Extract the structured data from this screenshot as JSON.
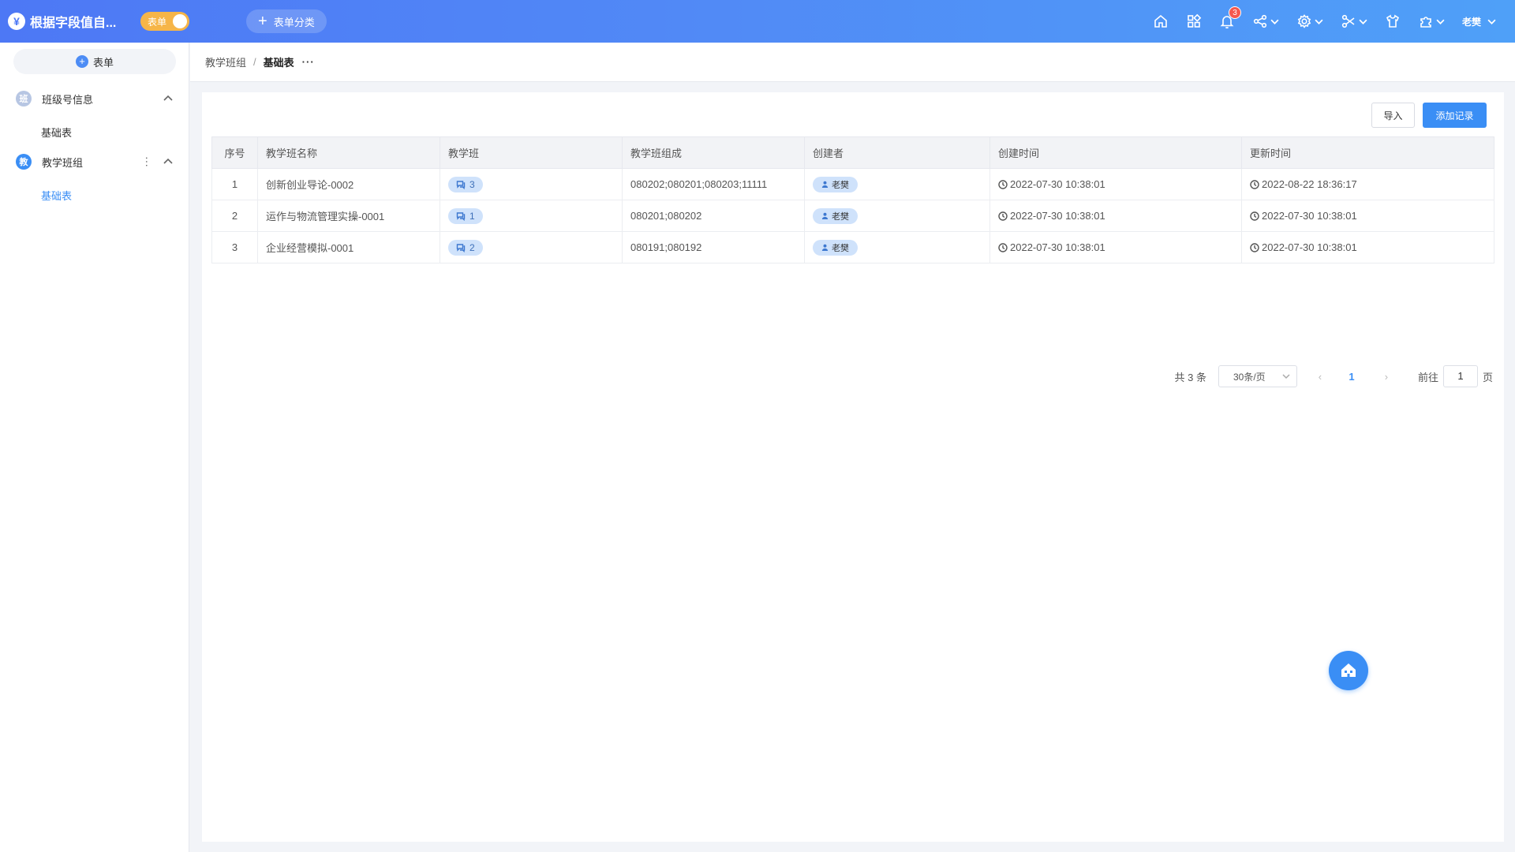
{
  "app": {
    "logo_glyph": "¥",
    "title": "根据字段值自...",
    "mode_toggle": "表单",
    "category_button": "表单分类",
    "notification_count": "3",
    "user_name": "老樊"
  },
  "sidebar": {
    "new_form_button": "表单",
    "groups": [
      {
        "avatar": "班",
        "avatar_color": "#b7c6e3",
        "label": "班级号信息",
        "items": [
          "基础表"
        ]
      },
      {
        "avatar": "教",
        "avatar_color": "#3a8ef5",
        "label": "教学班组",
        "items": [
          "基础表"
        ]
      }
    ],
    "active_item": "教学班组/基础表"
  },
  "breadcrumb": {
    "items": [
      "教学班组",
      "基础表"
    ],
    "separator": "/",
    "more": "···"
  },
  "toolbar": {
    "import_label": "导入",
    "add_label": "添加记录"
  },
  "table": {
    "columns": [
      "序号",
      "教学班名称",
      "教学班",
      "教学班组成",
      "创建者",
      "创建时间",
      "更新时间"
    ],
    "rows": [
      {
        "idx": "1",
        "name": "创新创业导论-0002",
        "classes": "3",
        "composition": "080202;080201;080203;11111",
        "creator": "老樊",
        "created": "2022-07-30 10:38:01",
        "updated": "2022-08-22 18:36:17"
      },
      {
        "idx": "2",
        "name": "运作与物流管理实操-0001",
        "classes": "1",
        "composition": "080201;080202",
        "creator": "老樊",
        "created": "2022-07-30 10:38:01",
        "updated": "2022-07-30 10:38:01"
      },
      {
        "idx": "3",
        "name": "企业经营模拟-0001",
        "classes": "2",
        "composition": "080191;080192",
        "creator": "老樊",
        "created": "2022-07-30 10:38:01",
        "updated": "2022-07-30 10:38:01"
      }
    ]
  },
  "pagination": {
    "total": "共 3 条",
    "page_size": "30条/页",
    "current_page": "1",
    "goto_label": "前往",
    "goto_value": "1",
    "page_suffix": "页"
  },
  "colors": {
    "accent": "#3a8ef5",
    "topbar_start": "#4d78f5",
    "topbar_end": "#4fa0f8",
    "toggle": "#f6b548"
  }
}
